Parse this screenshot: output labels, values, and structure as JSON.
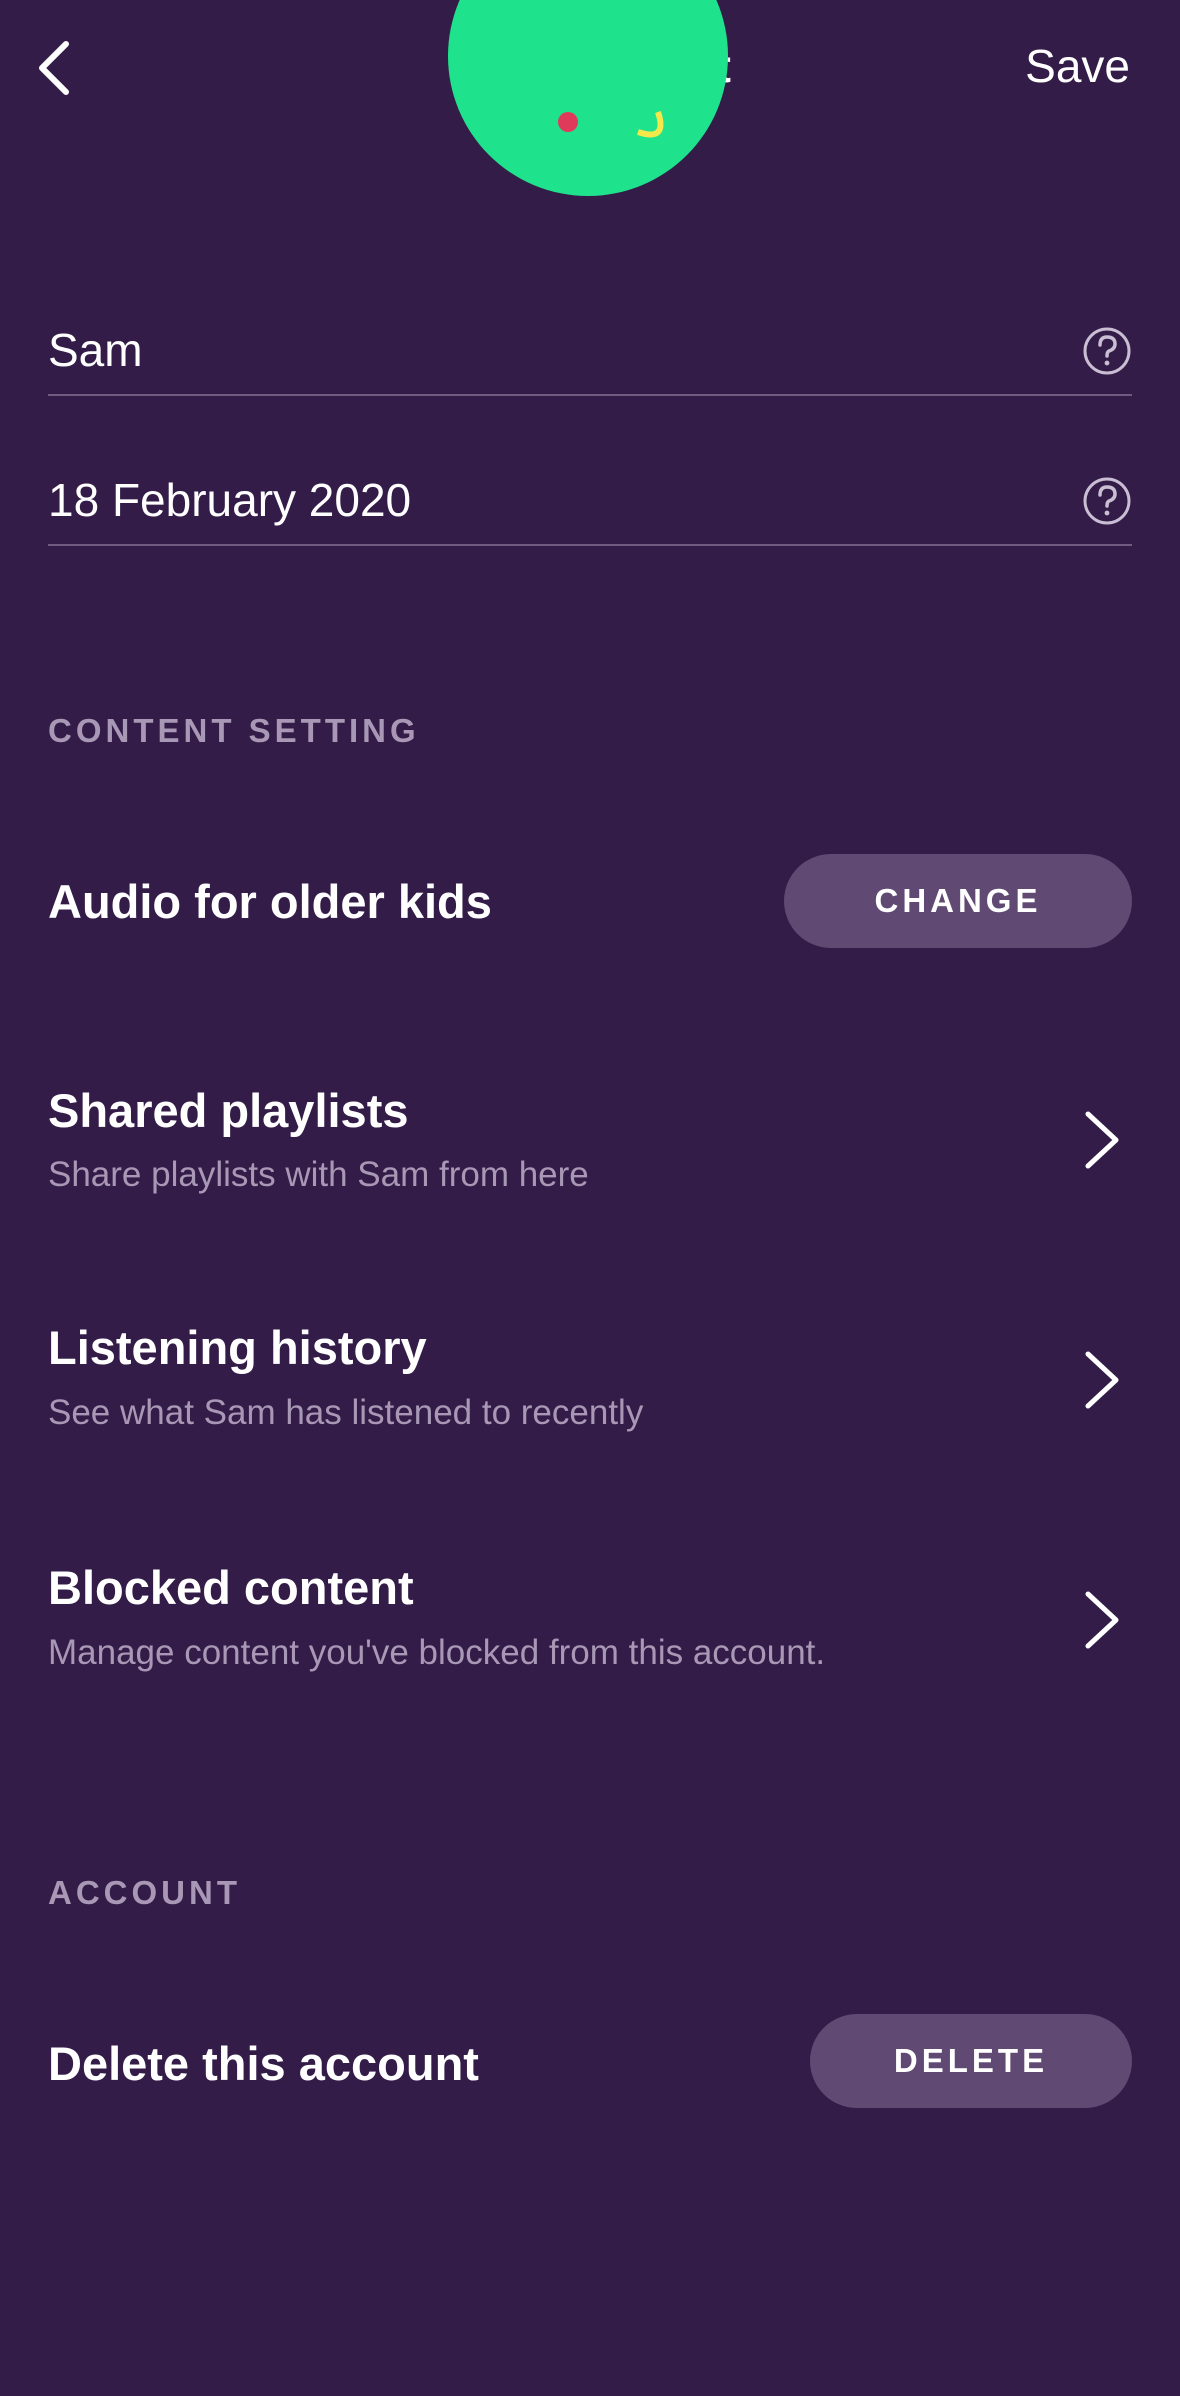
{
  "header": {
    "title": "Edit Account",
    "save_label": "Save"
  },
  "fields": {
    "name": {
      "value": "Sam"
    },
    "birthday": {
      "value": "18 February 2020"
    }
  },
  "content_setting": {
    "section_label": "CONTENT SETTING",
    "audio": {
      "title": "Audio for older kids",
      "button_label": "CHANGE"
    },
    "rows": [
      {
        "title": "Shared playlists",
        "subtitle": "Share playlists with Sam from here"
      },
      {
        "title": "Listening history",
        "subtitle": "See what Sam has listened to recently"
      },
      {
        "title": "Blocked content",
        "subtitle": "Manage content you've blocked from this account."
      }
    ]
  },
  "account": {
    "section_label": "ACCOUNT",
    "delete": {
      "title": "Delete this account",
      "button_label": "DELETE"
    }
  },
  "colors": {
    "background": "#341c48",
    "avatar": "#1ee38c",
    "button_bg": "#604a73",
    "subtext": "#a898b5",
    "divider": "#6f5b80"
  },
  "icons": {
    "back": "chevron-left-icon",
    "help": "question-circle-icon",
    "row_arrow": "chevron-right-icon"
  }
}
